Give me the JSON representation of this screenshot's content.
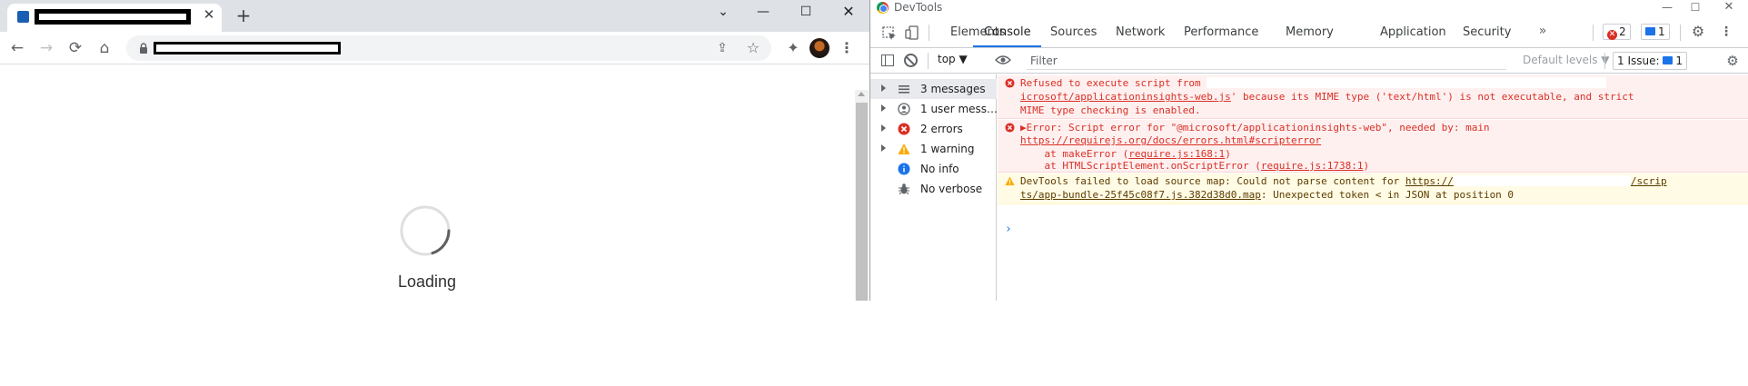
{
  "browser": {
    "tab": {
      "close_glyph": "✕"
    },
    "new_tab_glyph": "+",
    "window_controls": {
      "chevron": "⌄",
      "minimize": "—",
      "maximize": "☐",
      "close": "✕"
    },
    "toolbar": {
      "back": "←",
      "forward": "→",
      "reload": "⟳",
      "home": "⌂",
      "share": "⇪",
      "star": "☆",
      "extensions": "✦",
      "menu": "⋮"
    },
    "page": {
      "loading_text": "Loading"
    }
  },
  "devtools": {
    "title": "DevTools",
    "window_controls": {
      "minimize": "—",
      "maximize": "☐",
      "close": "✕"
    },
    "tabs": [
      {
        "label": "Elements"
      },
      {
        "label": "Console"
      },
      {
        "label": "Sources"
      },
      {
        "label": "Network"
      },
      {
        "label": "Performance"
      },
      {
        "label": "Memory"
      },
      {
        "label": "Application"
      },
      {
        "label": "Security"
      }
    ],
    "more_tabs_glyph": "»",
    "error_count": "2",
    "message_count": "1",
    "settings_glyph": "⚙",
    "kebab_glyph": "⋮",
    "console_toolbar": {
      "context": "top ▼",
      "filter_placeholder": "Filter",
      "levels": "Default levels ▼",
      "issues_label": "1 Issue:",
      "issues_count": "1"
    },
    "sidebar": [
      {
        "label": "3 messages",
        "icon": "list-icon"
      },
      {
        "label": "1 user mess…",
        "icon": "user-icon"
      },
      {
        "label": "2 errors",
        "icon": "error-icon"
      },
      {
        "label": "1 warning",
        "icon": "warning-icon"
      },
      {
        "label": "No info",
        "icon": "info-icon"
      },
      {
        "label": "No verbose",
        "icon": "bug-icon"
      }
    ],
    "messages": [
      {
        "level": "error",
        "line1": "Refused to execute script from",
        "line2_link": "icrosoft/applicationinsights-web.js",
        "line2_rest": "' because its MIME type ('text/html') is not executable, and strict",
        "line3": "MIME type checking is enabled."
      },
      {
        "level": "error",
        "line1": "▶Error: Script error for \"@microsoft/applicationinsights-web\", needed by: main",
        "line2_link": "https://requirejs.org/docs/errors.html#scripterror",
        "line3_prefix": "    at makeError (",
        "line3_link": "require.js:168:1",
        "line3_suffix": ")",
        "line4_prefix": "    at HTMLScriptElement.onScriptError (",
        "line4_link": "require.js:1738:1",
        "line4_suffix": ")"
      },
      {
        "level": "warning",
        "line1_prefix": "DevTools failed to load source map: Could not parse content for ",
        "line1_link": "https://",
        "line1_link2": "/scrip",
        "line2_link": "ts/app-bundle-25f45c08f7.js.382d38d0.map",
        "line2_rest": ": Unexpected token < in JSON at position 0"
      }
    ],
    "prompt": "›"
  }
}
